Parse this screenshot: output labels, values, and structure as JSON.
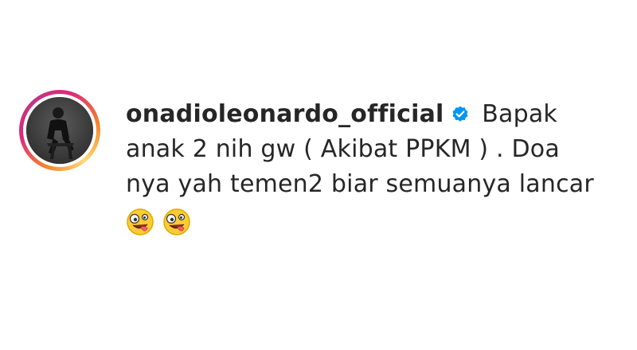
{
  "post": {
    "username": "onadioleonardo_official",
    "verified_icon": "verified-badge-icon",
    "caption_line1": "Bapak",
    "caption_line2": "anak 2 nih gw ( Akibat PPKM ) . Doa",
    "caption_line3": "nya yah temen2 biar semuanya lancar",
    "emojis": [
      "zany-face-icon",
      "zany-face-icon"
    ]
  },
  "colors": {
    "text": "#262626",
    "verified_blue": "#0095f6",
    "ring_orange": "#f58529",
    "ring_pink": "#dd2a7b",
    "ring_purple": "#c13584"
  }
}
